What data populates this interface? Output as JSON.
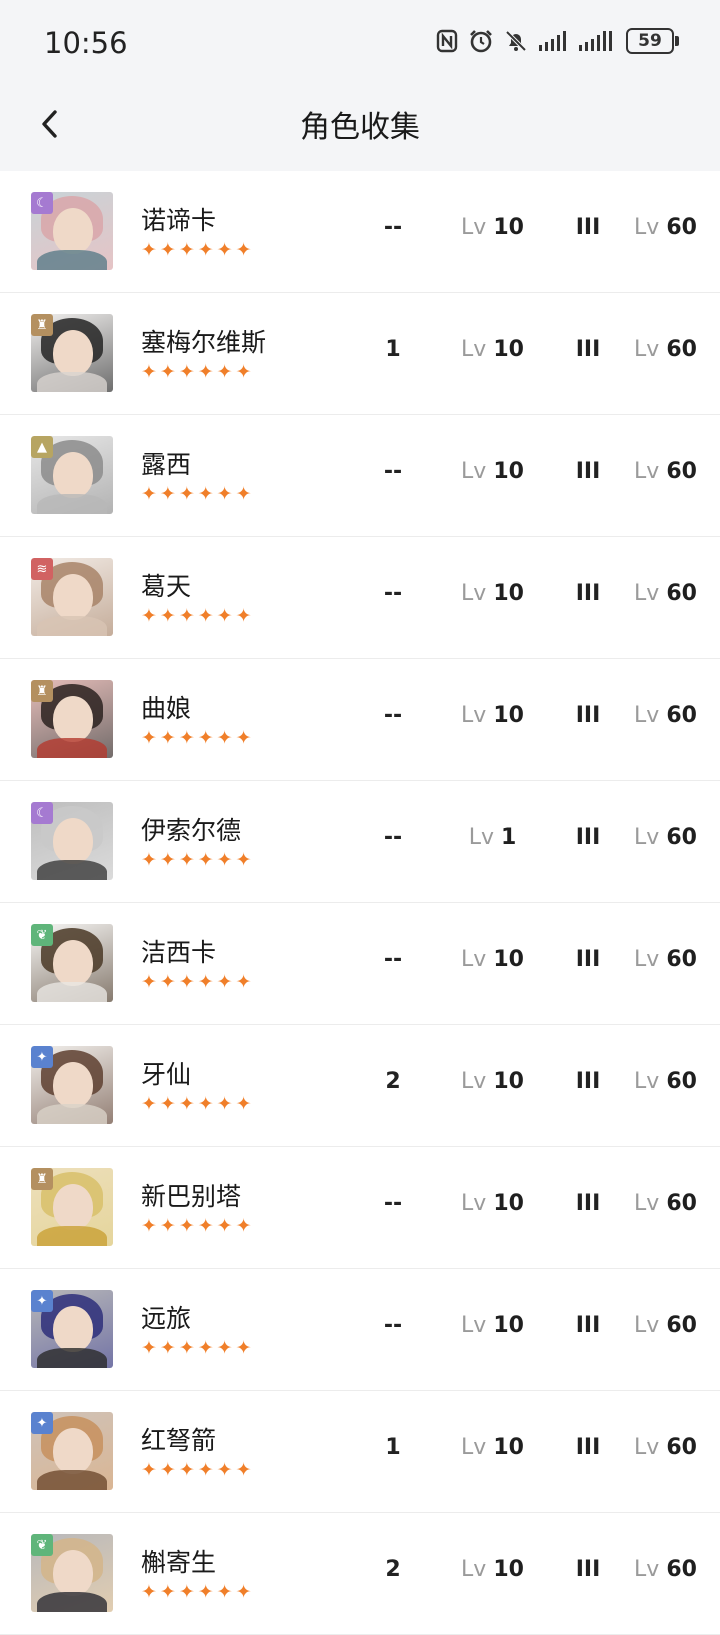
{
  "status_bar": {
    "time": "10:56",
    "battery": "59",
    "icons": [
      "nfc-icon",
      "alarm-icon",
      "mute-icon",
      "signal-icon",
      "signal-icon-2",
      "battery-icon"
    ]
  },
  "nav": {
    "title": "角色收集",
    "back_icon": "chevron-left-icon"
  },
  "colors": {
    "star": "#f07f2a",
    "badge_purple": "#a57ad1",
    "badge_gold": "#b49060",
    "badge_olive": "#b7a562",
    "badge_red": "#d16262",
    "badge_green": "#5fb57a",
    "badge_blue": "#5a82cf"
  },
  "lv_prefix": "Lv",
  "star_glyphs": "✦✦✦✦✦✦",
  "characters": [
    {
      "name": "诺谛卡",
      "stars": 6,
      "rank": "--",
      "level": "10",
      "tier": "III",
      "max_level": "60",
      "badge_icon": "moon-icon",
      "badge_color": "#a57ad1",
      "hair": "#d9a6a9",
      "body": "#5a7c88"
    },
    {
      "name": "塞梅尔维斯",
      "stars": 6,
      "rank": "1",
      "level": "10",
      "tier": "III",
      "max_level": "60",
      "badge_icon": "tower-icon",
      "badge_color": "#b49060",
      "hair": "#252525",
      "body": "#d8d3cf"
    },
    {
      "name": "露西",
      "stars": 6,
      "rank": "--",
      "level": "10",
      "tier": "III",
      "max_level": "60",
      "badge_icon": "mountain-icon",
      "badge_color": "#b7a562",
      "hair": "#8c8c8c",
      "body": "#b8b8b8"
    },
    {
      "name": "葛天",
      "stars": 6,
      "rank": "--",
      "level": "10",
      "tier": "III",
      "max_level": "60",
      "badge_icon": "flame-icon",
      "badge_color": "#d16262",
      "hair": "#a88468",
      "body": "#d8c4b4"
    },
    {
      "name": "曲娘",
      "stars": 6,
      "rank": "--",
      "level": "10",
      "tier": "III",
      "max_level": "60",
      "badge_icon": "tower-icon",
      "badge_color": "#b49060",
      "hair": "#2c2220",
      "body": "#b43a2e"
    },
    {
      "name": "伊索尔德",
      "stars": 6,
      "rank": "--",
      "level": "1",
      "tier": "III",
      "max_level": "60",
      "badge_icon": "moon-icon",
      "badge_color": "#a57ad1",
      "hair": "#c9c9c9",
      "body": "#3a3a3a"
    },
    {
      "name": "洁西卡",
      "stars": 6,
      "rank": "--",
      "level": "10",
      "tier": "III",
      "max_level": "60",
      "badge_icon": "leaf-icon",
      "badge_color": "#5fb57a",
      "hair": "#4a3826",
      "body": "#e8e6e2"
    },
    {
      "name": "牙仙",
      "stars": 6,
      "rank": "2",
      "level": "10",
      "tier": "III",
      "max_level": "60",
      "badge_icon": "star-icon",
      "badge_color": "#5a82cf",
      "hair": "#5e4030",
      "body": "#d9d2c8"
    },
    {
      "name": "新巴别塔",
      "stars": 6,
      "rank": "--",
      "level": "10",
      "tier": "III",
      "max_level": "60",
      "badge_icon": "tower-icon",
      "badge_color": "#b49060",
      "hair": "#d8c06a",
      "body": "#c9a034"
    },
    {
      "name": "远旅",
      "stars": 6,
      "rank": "--",
      "level": "10",
      "tier": "III",
      "max_level": "60",
      "badge_icon": "star-icon",
      "badge_color": "#5a82cf",
      "hair": "#2e2f7a",
      "body": "#2a2a2a"
    },
    {
      "name": "红弩箭",
      "stars": 6,
      "rank": "1",
      "level": "10",
      "tier": "III",
      "max_level": "60",
      "badge_icon": "star-icon",
      "badge_color": "#5a82cf",
      "hair": "#c7915e",
      "body": "#6e4a2e"
    },
    {
      "name": "槲寄生",
      "stars": 6,
      "rank": "2",
      "level": "10",
      "tier": "III",
      "max_level": "60",
      "badge_icon": "leaf-icon",
      "badge_color": "#5fb57a",
      "hair": "#d3b58a",
      "body": "#2a2a32"
    }
  ]
}
